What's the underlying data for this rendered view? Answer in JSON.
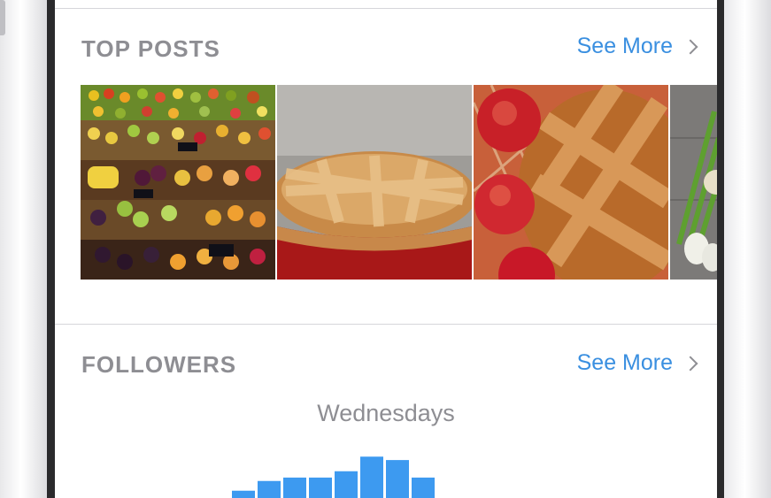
{
  "top_posts": {
    "title": "TOP POSTS",
    "see_more": "See More",
    "photos": [
      {
        "icon": "market-produce-photo"
      },
      {
        "icon": "lattice-pie-photo"
      },
      {
        "icon": "apple-pie-photo"
      },
      {
        "icon": "green-onions-photo"
      }
    ]
  },
  "followers": {
    "title": "FOLLOWERS",
    "see_more": "See More",
    "subtitle": "Wednesdays",
    "bar_color": "#3d9af0",
    "relative_levels": [
      0.15,
      0.35,
      0.42,
      0.42,
      0.55,
      0.85,
      0.78,
      0.42
    ]
  },
  "colors": {
    "accent": "#3a8fe0",
    "section_title": "#8e8e93",
    "bar": "#3d9af0"
  }
}
